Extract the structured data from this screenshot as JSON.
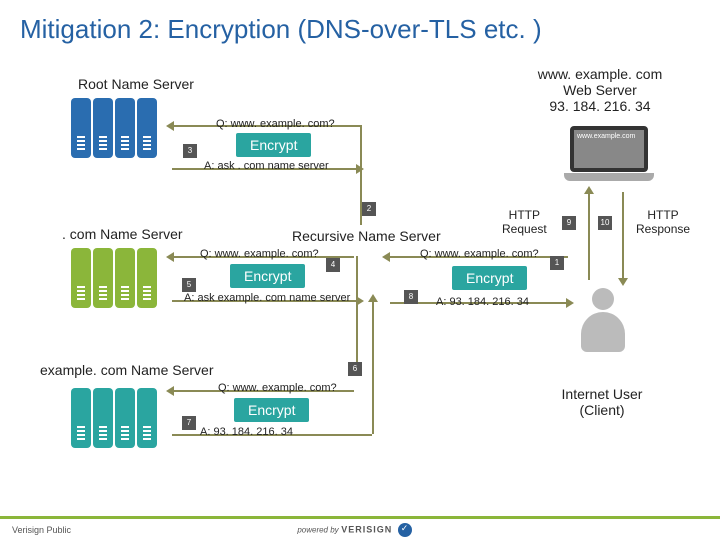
{
  "title": "Mitigation 2:  Encryption (DNS-over-TLS etc. )",
  "labels": {
    "root": "Root Name Server",
    "com": ". com Name Server",
    "example": "example. com Name Server",
    "recursive": "Recursive Name Server",
    "web_line1": "www. example. com",
    "web_line2": "Web Server",
    "web_line3": "93. 184. 216. 34",
    "client_line1": "Internet User",
    "client_line2": "(Client)",
    "http_req": "HTTP\nRequest",
    "http_res": "HTTP\nResponse"
  },
  "qa": {
    "q_root": "Q: www. example. com?",
    "a_root": "A: ask . com name server",
    "q_com": "Q: www. example. com?",
    "a_com": "A: ask example. com name server",
    "q_ex": "Q: www. example. com?",
    "a_ex": "A: 93. 184. 216. 34",
    "q_client": "Q: www. example. com?",
    "a_client": "A: 93. 184. 216. 34"
  },
  "encrypt": "Encrypt",
  "steps": {
    "s1": "1",
    "s2": "2",
    "s3": "3",
    "s4": "4",
    "s5": "5",
    "s6": "6",
    "s7": "7",
    "s8": "8",
    "s9": "9",
    "s10": "10"
  },
  "laptop_url": "www.example.com",
  "footer": {
    "left": "Verisign Public",
    "powered": "powered by",
    "brand": "VERISIGN"
  }
}
